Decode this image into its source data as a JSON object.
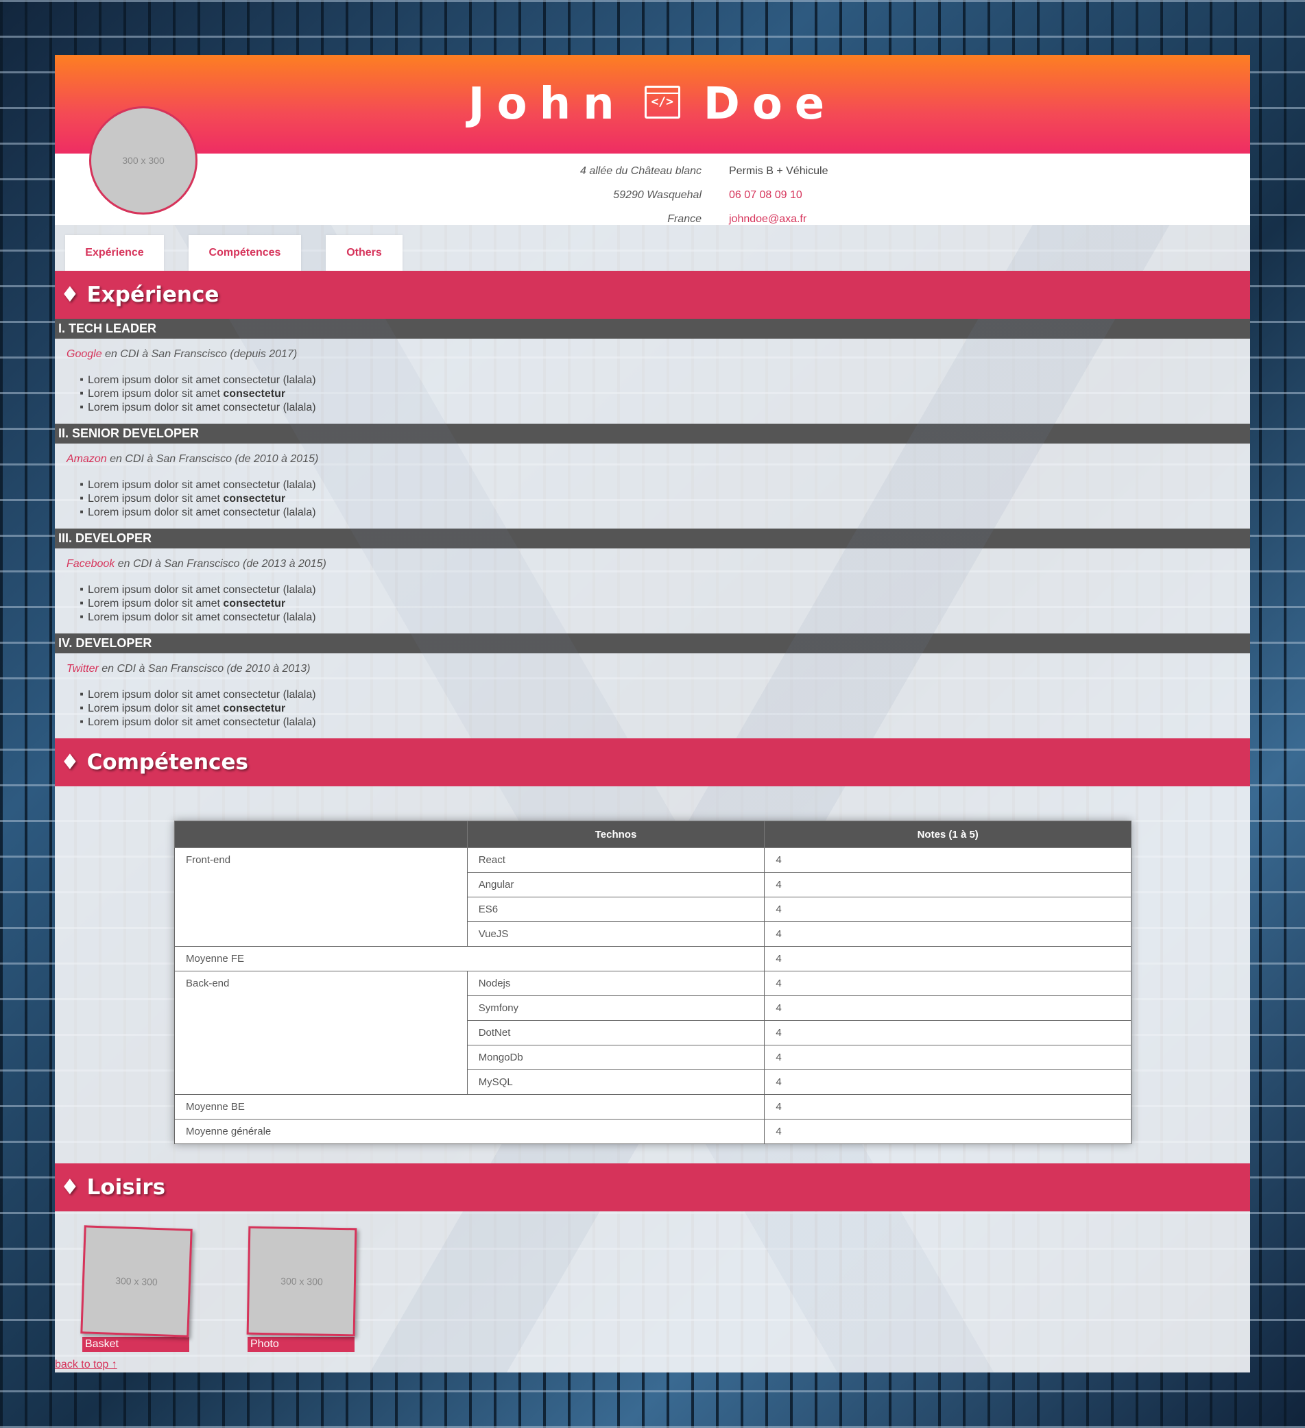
{
  "header": {
    "first_name": "John",
    "last_name": "Doe",
    "code_icon_glyph": "</>",
    "avatar_placeholder": "300 x 300"
  },
  "contact": {
    "address_line1": "4 allée du Château blanc",
    "address_line2": "59290 Wasquehal",
    "address_line3": "France",
    "license": "Permis B + Véhicule",
    "phone": "06 07 08 09 10",
    "email": "johndoe@axa.fr"
  },
  "nav": {
    "tabs": [
      {
        "label": "Expérience"
      },
      {
        "label": "Compétences"
      },
      {
        "label": "Others"
      }
    ]
  },
  "experience": {
    "title": "♦ Expérience",
    "jobs": [
      {
        "title": "I. TECH LEADER",
        "company": "Google",
        "detail": " en CDI à San Franscisco (depuis 2017)"
      },
      {
        "title": "II. SENIOR DEVELOPER",
        "company": "Amazon",
        "detail": " en CDI à San Franscisco (de 2010 à 2015)"
      },
      {
        "title": "III. DEVELOPER",
        "company": "Facebook",
        "detail": " en CDI à San Franscisco (de 2013 à 2015)"
      },
      {
        "title": "IV. DEVELOPER",
        "company": "Twitter",
        "detail": " en CDI à San Franscisco (de 2010 à 2013)"
      }
    ],
    "bullets": {
      "line1": "Lorem ipsum dolor sit amet consectetur (lalala)",
      "line2_prefix": "Lorem ipsum dolor sit amet ",
      "line2_bold": "consectetur",
      "line3": "Lorem ipsum dolor sit amet consectetur (lalala)"
    }
  },
  "skills": {
    "title": "♦ Compétences",
    "headers": [
      "",
      "Technos",
      "Notes (1 à 5)"
    ],
    "frontend": {
      "label": "Front-end",
      "rows": [
        {
          "tech": "React",
          "note": "4"
        },
        {
          "tech": "Angular",
          "note": "4"
        },
        {
          "tech": "ES6",
          "note": "4"
        },
        {
          "tech": "VueJS",
          "note": "4"
        }
      ],
      "avg_label": "Moyenne FE",
      "avg": "4"
    },
    "backend": {
      "label": "Back-end",
      "rows": [
        {
          "tech": "Nodejs",
          "note": "4"
        },
        {
          "tech": "Symfony",
          "note": "4"
        },
        {
          "tech": "DotNet",
          "note": "4"
        },
        {
          "tech": "MongoDb",
          "note": "4"
        },
        {
          "tech": "MySQL",
          "note": "4"
        }
      ],
      "avg_label": "Moyenne BE",
      "avg": "4"
    },
    "overall_label": "Moyenne générale",
    "overall": "4"
  },
  "hobbies": {
    "title": "♦ Loisirs",
    "items": [
      {
        "label": "Basket",
        "placeholder": "300 x 300"
      },
      {
        "label": "Photo",
        "placeholder": "300 x 300"
      }
    ]
  },
  "footer": {
    "back_to_top": "back to top ↑"
  }
}
